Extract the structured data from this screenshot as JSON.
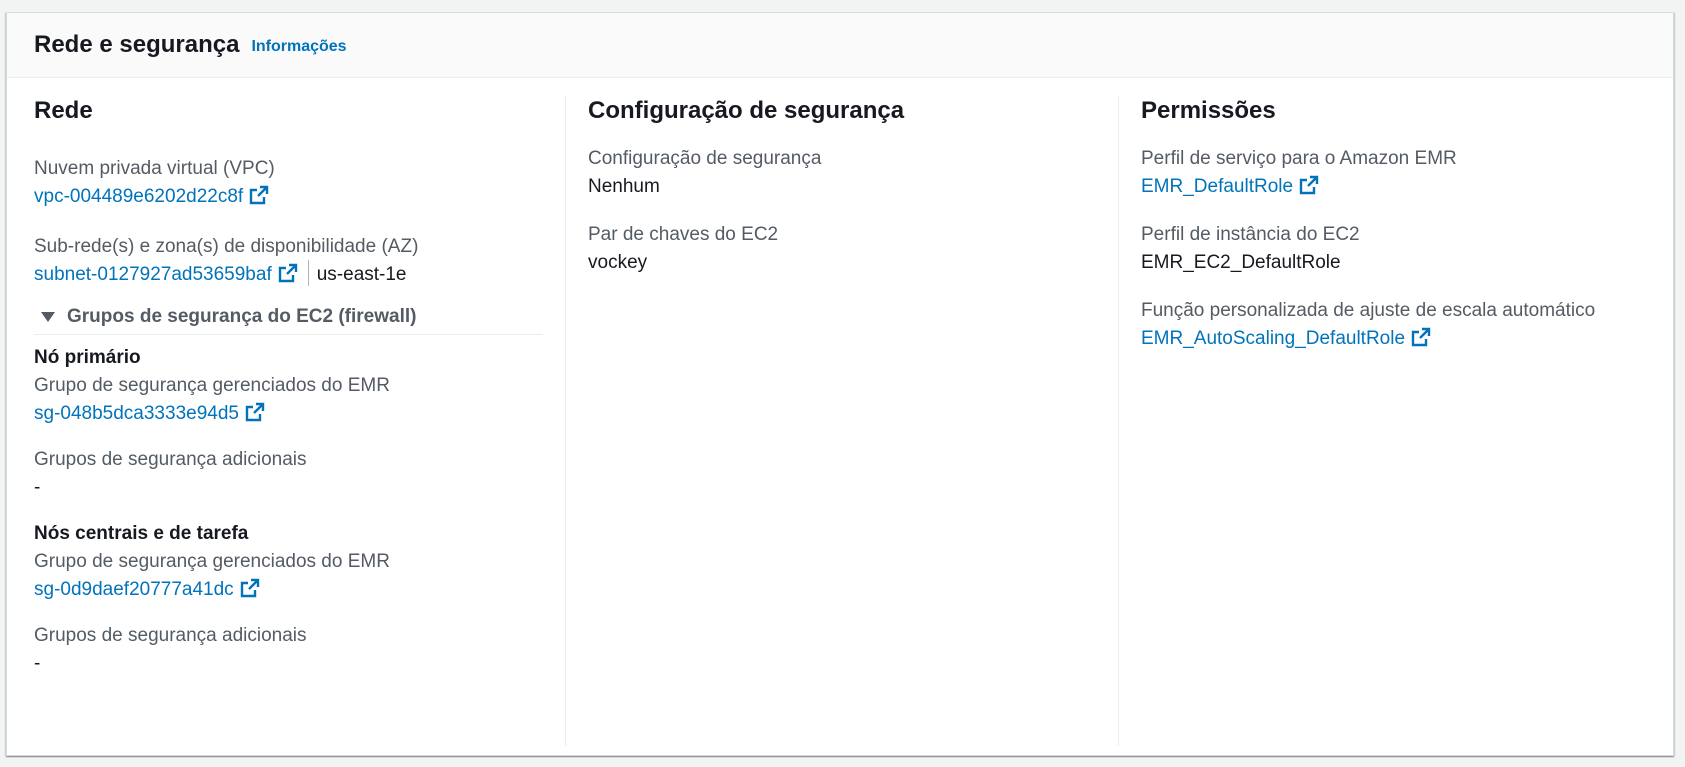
{
  "header": {
    "title": "Rede e segurança",
    "info_link": "Informações"
  },
  "rede": {
    "title": "Rede",
    "vpc_label": "Nuvem privada virtual (VPC)",
    "vpc_value": "vpc-004489e6202d22c8f",
    "subnet_label": "Sub-rede(s) e zona(s) de disponibilidade (AZ)",
    "subnet_value": "subnet-0127927ad53659baf",
    "az_value": "us-east-1e",
    "sg_expander_label": "Grupos de segurança do EC2 (firewall)",
    "primary": {
      "title": "Nó primário",
      "managed_label": "Grupo de segurança gerenciados do EMR",
      "managed_value": "sg-048b5dca3333e94d5",
      "additional_label": "Grupos de segurança adicionais",
      "additional_value": "-"
    },
    "core": {
      "title": "Nós centrais e de tarefa",
      "managed_label": "Grupo de segurança gerenciados do EMR",
      "managed_value": "sg-0d9daef20777a41dc",
      "additional_label": "Grupos de segurança adicionais",
      "additional_value": "-"
    }
  },
  "security_config": {
    "title": "Configuração de segurança",
    "config_label": "Configuração de segurança",
    "config_value": "Nenhum",
    "keypair_label": "Par de chaves do EC2",
    "keypair_value": "vockey"
  },
  "permissions": {
    "title": "Permissões",
    "service_role_label": "Perfil de serviço para o Amazon EMR",
    "service_role_value": "EMR_DefaultRole",
    "instance_profile_label": "Perfil de instância do EC2",
    "instance_profile_value": "EMR_EC2_DefaultRole",
    "autoscaling_label": "Função personalizada de ajuste de escala automático",
    "autoscaling_value": "EMR_AutoScaling_DefaultRole"
  },
  "colors": {
    "link": "#0073bb",
    "text": "#16191f",
    "label": "#545b64"
  },
  "icons": {
    "external": "external-link-icon",
    "caret": "caret-down-icon"
  }
}
